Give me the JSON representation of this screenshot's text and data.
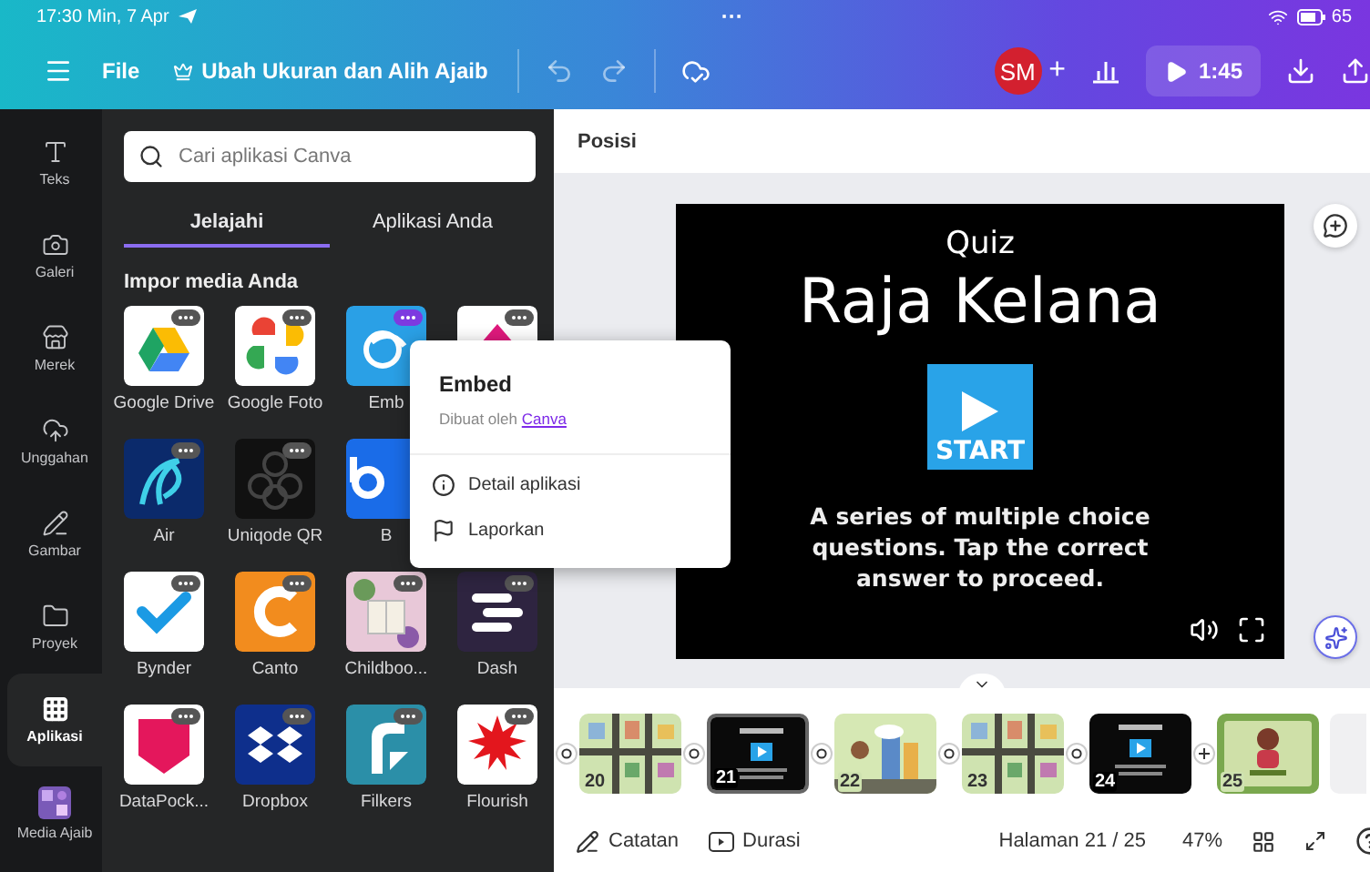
{
  "status_bar": {
    "time": "17:30 Min, 7 Apr",
    "dots": "···",
    "battery": "65"
  },
  "toolbar": {
    "file": "File",
    "title": "Ubah Ukuran dan Alih Ajaib",
    "avatar": "SM",
    "add": "+",
    "timer": "1:45"
  },
  "rail": [
    {
      "label": "Teks",
      "selected": false
    },
    {
      "label": "Galeri",
      "selected": false
    },
    {
      "label": "Merek",
      "selected": false
    },
    {
      "label": "Unggahan",
      "selected": false
    },
    {
      "label": "Gambar",
      "selected": false
    },
    {
      "label": "Proyek",
      "selected": false
    },
    {
      "label": "Aplikasi",
      "selected": true
    },
    {
      "label": "Media Ajaib",
      "selected": false
    }
  ],
  "panel": {
    "search_placeholder": "Cari aplikasi Canva",
    "tabs": [
      {
        "label": "Jelajahi",
        "selected": true
      },
      {
        "label": "Aplikasi Anda",
        "selected": false
      }
    ],
    "section": "Impor media Anda",
    "app_rows": [
      [
        {
          "label": "Google Drive",
          "active": false
        },
        {
          "label": "Google Foto",
          "active": false
        },
        {
          "label": "Emb",
          "active": true
        },
        {
          "active": false
        }
      ],
      [
        {
          "label": "Air",
          "active": false
        },
        {
          "label": "Uniqode QR",
          "active": false
        },
        {
          "label": "B"
        }
      ],
      [
        {
          "label": "Bynder",
          "active": false
        },
        {
          "label": "Canto",
          "active": false
        },
        {
          "label": "Childboo...",
          "active": false
        },
        {
          "label": "Dash",
          "active": false
        }
      ],
      [
        {
          "label": "DataPock...",
          "active": false
        },
        {
          "label": "Dropbox",
          "active": false
        },
        {
          "label": "Filkers",
          "active": false
        },
        {
          "label": "Flourish",
          "active": false
        }
      ]
    ]
  },
  "popup": {
    "title": "Embed",
    "byline": "Dibuat oleh",
    "author": "Canva",
    "items": [
      "Detail aplikasi",
      "Laporkan"
    ]
  },
  "canvas": {
    "header": "Posisi",
    "slide": {
      "kicker": "Quiz",
      "title": "Raja Kelana",
      "button": "START",
      "description": "A series of multiple choice questions. Tap the correct answer to proceed."
    }
  },
  "filmstrip": [
    {
      "number": "20",
      "kind": "map",
      "selected": false
    },
    {
      "number": "21",
      "kind": "quiz",
      "selected": true
    },
    {
      "number": "22",
      "kind": "scene",
      "selected": false
    },
    {
      "number": "23",
      "kind": "map",
      "selected": false
    },
    {
      "number": "24",
      "kind": "quiz",
      "selected": false
    },
    {
      "number": "25",
      "kind": "award",
      "selected": false
    }
  ],
  "footer": {
    "notes": "Catatan",
    "duration": "Durasi",
    "page": "Halaman 21 / 25",
    "zoom": "47%"
  }
}
